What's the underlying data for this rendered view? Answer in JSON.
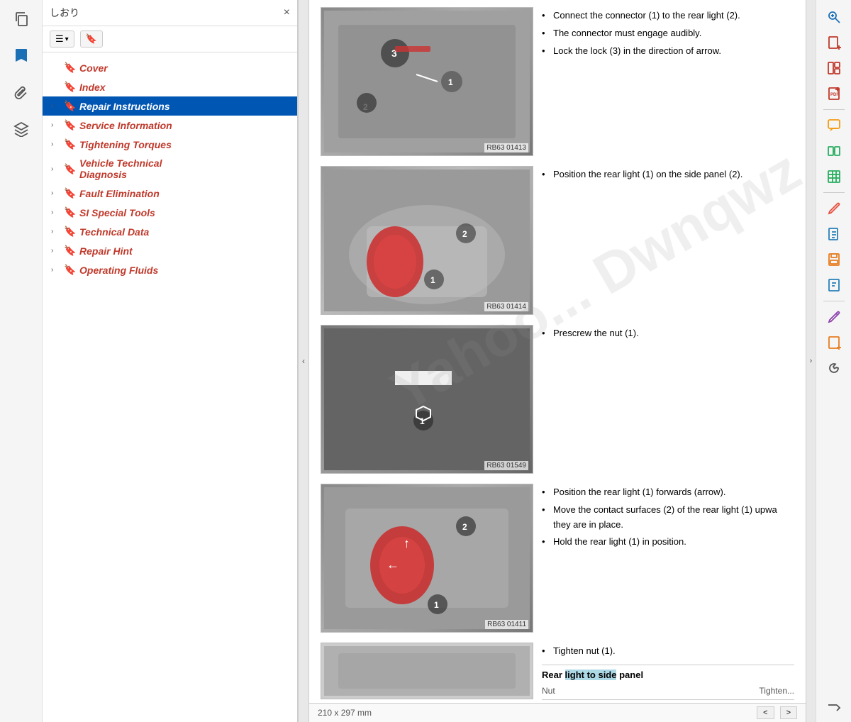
{
  "sidebar": {
    "title": "しおり",
    "close_label": "×",
    "toolbar": {
      "list_btn": "≡",
      "dropdown_arrow": "▾",
      "bookmark_btn": "🔖"
    },
    "nav_items": [
      {
        "id": "cover",
        "label": "Cover",
        "has_chevron": false,
        "active": false
      },
      {
        "id": "index",
        "label": "Index",
        "has_chevron": false,
        "active": false
      },
      {
        "id": "repair-instructions",
        "label": "Repair Instructions",
        "has_chevron": true,
        "active": true
      },
      {
        "id": "service-information",
        "label": "Service Information",
        "has_chevron": true,
        "active": false
      },
      {
        "id": "tightening-torques",
        "label": "Tightening Torques",
        "has_chevron": true,
        "active": false
      },
      {
        "id": "vehicle-technical-diagnosis",
        "label": "Vehicle Technical Diagnosis",
        "has_chevron": true,
        "active": false
      },
      {
        "id": "fault-elimination",
        "label": "Fault Elimination",
        "has_chevron": true,
        "active": false
      },
      {
        "id": "si-special-tools",
        "label": "SI Special Tools",
        "has_chevron": true,
        "active": false
      },
      {
        "id": "technical-data",
        "label": "Technical Data",
        "has_chevron": true,
        "active": false
      },
      {
        "id": "repair-hint",
        "label": "Repair Hint",
        "has_chevron": true,
        "active": false
      },
      {
        "id": "operating-fluids",
        "label": "Operating Fluids",
        "has_chevron": true,
        "active": false
      }
    ]
  },
  "content": {
    "sections": [
      {
        "id": "section1",
        "image_id": "RB63 01413",
        "instructions": [
          "Connect the connector (1) to the rear light (2).",
          "The connector  must engage audibly.",
          "Lock the lock (3) in the direction of arrow."
        ]
      },
      {
        "id": "section2",
        "image_id": "RB63 01414",
        "instructions": [
          "Position the rear light (1) on the side panel (2)."
        ]
      },
      {
        "id": "section3",
        "image_id": "RB63 01549",
        "instructions": [
          "Prescrew the nut (1)."
        ]
      },
      {
        "id": "section4",
        "image_id": "RB63 01411",
        "instructions": [
          "Position the rear light (1) forwards (arrow).",
          "Move the contact surfaces (2) of the rear light (1) upwa they are in place.",
          "Hold the rear light (1) in position."
        ]
      },
      {
        "id": "section5",
        "image_id": "",
        "instructions": [
          "Tighten nut (1)."
        ],
        "table_header": "Rear light to side panel",
        "table_partial": "Nut",
        "table_col": "Tighten..."
      }
    ]
  },
  "bottom_bar": {
    "size_label": "210 x 297 mm",
    "nav_left": "<",
    "nav_right": ">"
  },
  "right_toolbar": {
    "buttons": [
      {
        "id": "zoom",
        "icon": "🔍",
        "color": "blue"
      },
      {
        "id": "doc-plus",
        "icon": "📄+",
        "color": "red"
      },
      {
        "id": "layout",
        "icon": "▦",
        "color": "red"
      },
      {
        "id": "pdf-plus",
        "icon": "📋+",
        "color": "red"
      },
      {
        "id": "comment",
        "icon": "💬",
        "color": "yellow"
      },
      {
        "id": "compare",
        "icon": "🔄",
        "color": "green"
      },
      {
        "id": "spreadsheet",
        "icon": "📊",
        "color": "green"
      },
      {
        "id": "annotate",
        "icon": "📝",
        "color": "red"
      },
      {
        "id": "edit",
        "icon": "✏️",
        "color": "red"
      },
      {
        "id": "doc-save",
        "icon": "📁",
        "color": "orange"
      },
      {
        "id": "doc-view",
        "icon": "📋",
        "color": "blue"
      },
      {
        "id": "edit2",
        "icon": "✏️",
        "color": "purple"
      },
      {
        "id": "doc-yellow",
        "icon": "📄",
        "color": "orange"
      },
      {
        "id": "wrench",
        "icon": "🔧",
        "color": "blue"
      },
      {
        "id": "export",
        "icon": "↪",
        "color": "gray"
      }
    ]
  },
  "watermark": "Yahoo... Dwnqwz"
}
